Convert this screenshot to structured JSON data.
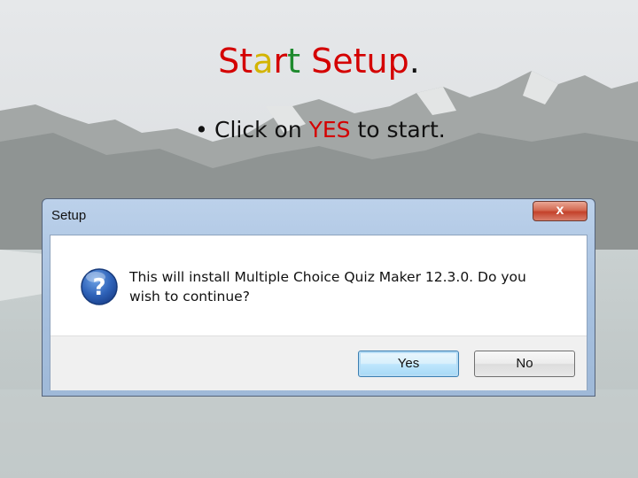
{
  "slide": {
    "title_parts": [
      {
        "text": "St",
        "color": "#d40000"
      },
      {
        "text": "a",
        "color": "#d3b400"
      },
      {
        "text": "r",
        "color": "#d40000"
      },
      {
        "text": "t ",
        "color": "#1e8a2e"
      },
      {
        "text": "Setup",
        "color": "#d40000"
      },
      {
        "text": ".",
        "color": "#111111"
      }
    ],
    "bullet": {
      "prefix": "Click on ",
      "highlight": "YES",
      "suffix": " to start."
    }
  },
  "dialog": {
    "title": "Setup",
    "close_label": "x",
    "message": "This will install Multiple Choice Quiz Maker 12.3.0. Do you wish to continue?",
    "icon": "question-icon",
    "buttons": {
      "yes": "Yes",
      "no": "No"
    }
  }
}
